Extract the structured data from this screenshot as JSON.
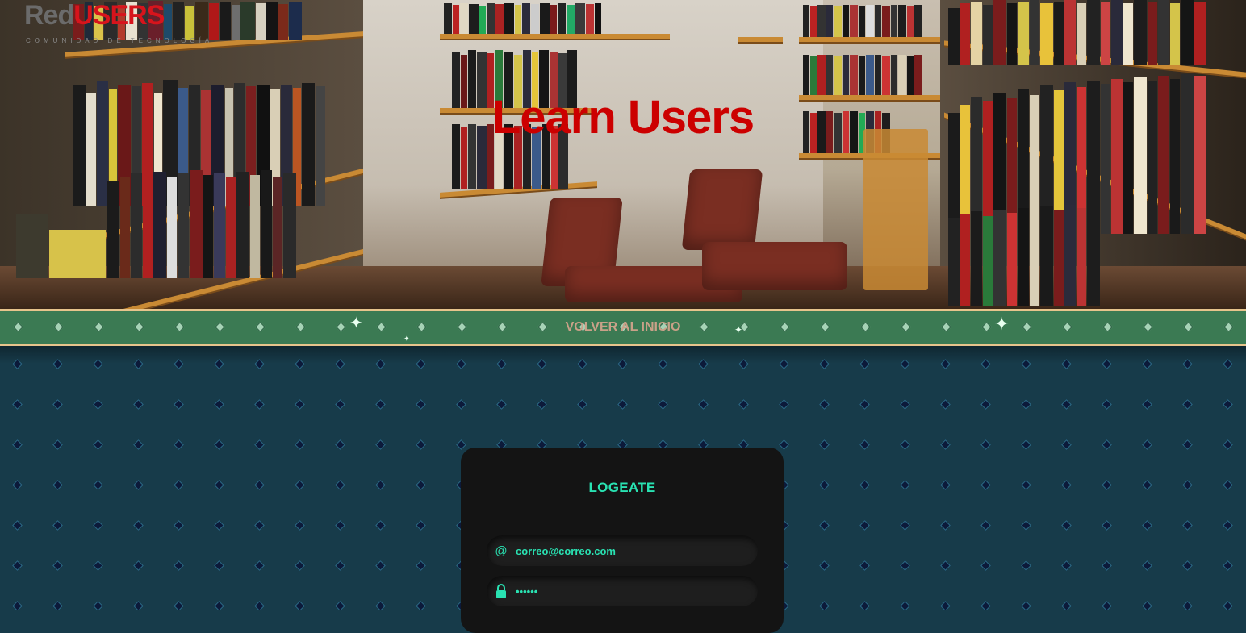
{
  "brand": {
    "logo_part1": "Red",
    "logo_part2": "USERS",
    "logo_sub": "COMUNIDAD DE TECNOLOGÍA"
  },
  "hero": {
    "title": "Learn Users"
  },
  "nav": {
    "back_link": "VOLVER AL INICIO"
  },
  "login": {
    "title": "LOGEATE",
    "email": {
      "icon": "at-icon",
      "value": "correo@correo.com"
    },
    "password": {
      "icon": "lock-icon",
      "value": "••••••"
    }
  },
  "colors": {
    "accent": "#29e2b2",
    "hero_title": "#cc0000",
    "nav_bg": "#3b7a53",
    "page_bg": "#173b4a",
    "card_bg": "#141414"
  }
}
